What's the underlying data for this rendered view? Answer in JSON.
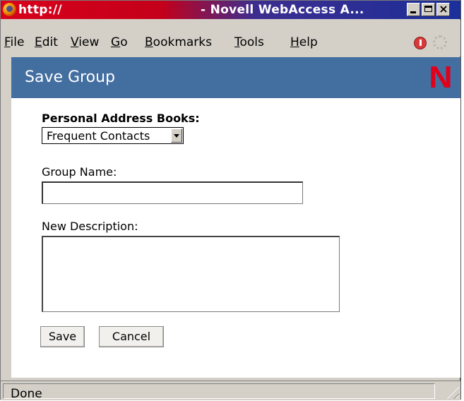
{
  "window": {
    "title_url": "http://",
    "title_app": "- Novell WebAccess A...",
    "controls": {
      "minimize": "minimize-button",
      "maximize": "maximize-button",
      "close": "×"
    }
  },
  "menubar": {
    "items": [
      {
        "label": "File",
        "accel": "F",
        "rest": "ile"
      },
      {
        "label": "Edit",
        "accel": "E",
        "rest": "dit"
      },
      {
        "label": "View",
        "accel": "V",
        "rest": "iew"
      },
      {
        "label": "Go",
        "accel": "G",
        "rest": "o"
      },
      {
        "label": "Bookmarks",
        "accel": "B",
        "rest": "ookmarks"
      },
      {
        "label": "Tools",
        "accel": "T",
        "rest": "ools"
      },
      {
        "label": "Help",
        "accel": "H",
        "rest": "elp"
      }
    ]
  },
  "page": {
    "header_title": "Save Group",
    "logo": "N",
    "address_books_label": "Personal Address Books:",
    "address_book_selected": "Frequent Contacts",
    "group_name_label": "Group Name:",
    "group_name_value": "",
    "description_label": "New Description:",
    "description_value": "",
    "save_label": "Save",
    "cancel_label": "Cancel"
  },
  "status": {
    "text": "Done"
  },
  "colors": {
    "header": "#436ea0",
    "logo": "#e0001b",
    "chrome": "#d4d0c8"
  }
}
